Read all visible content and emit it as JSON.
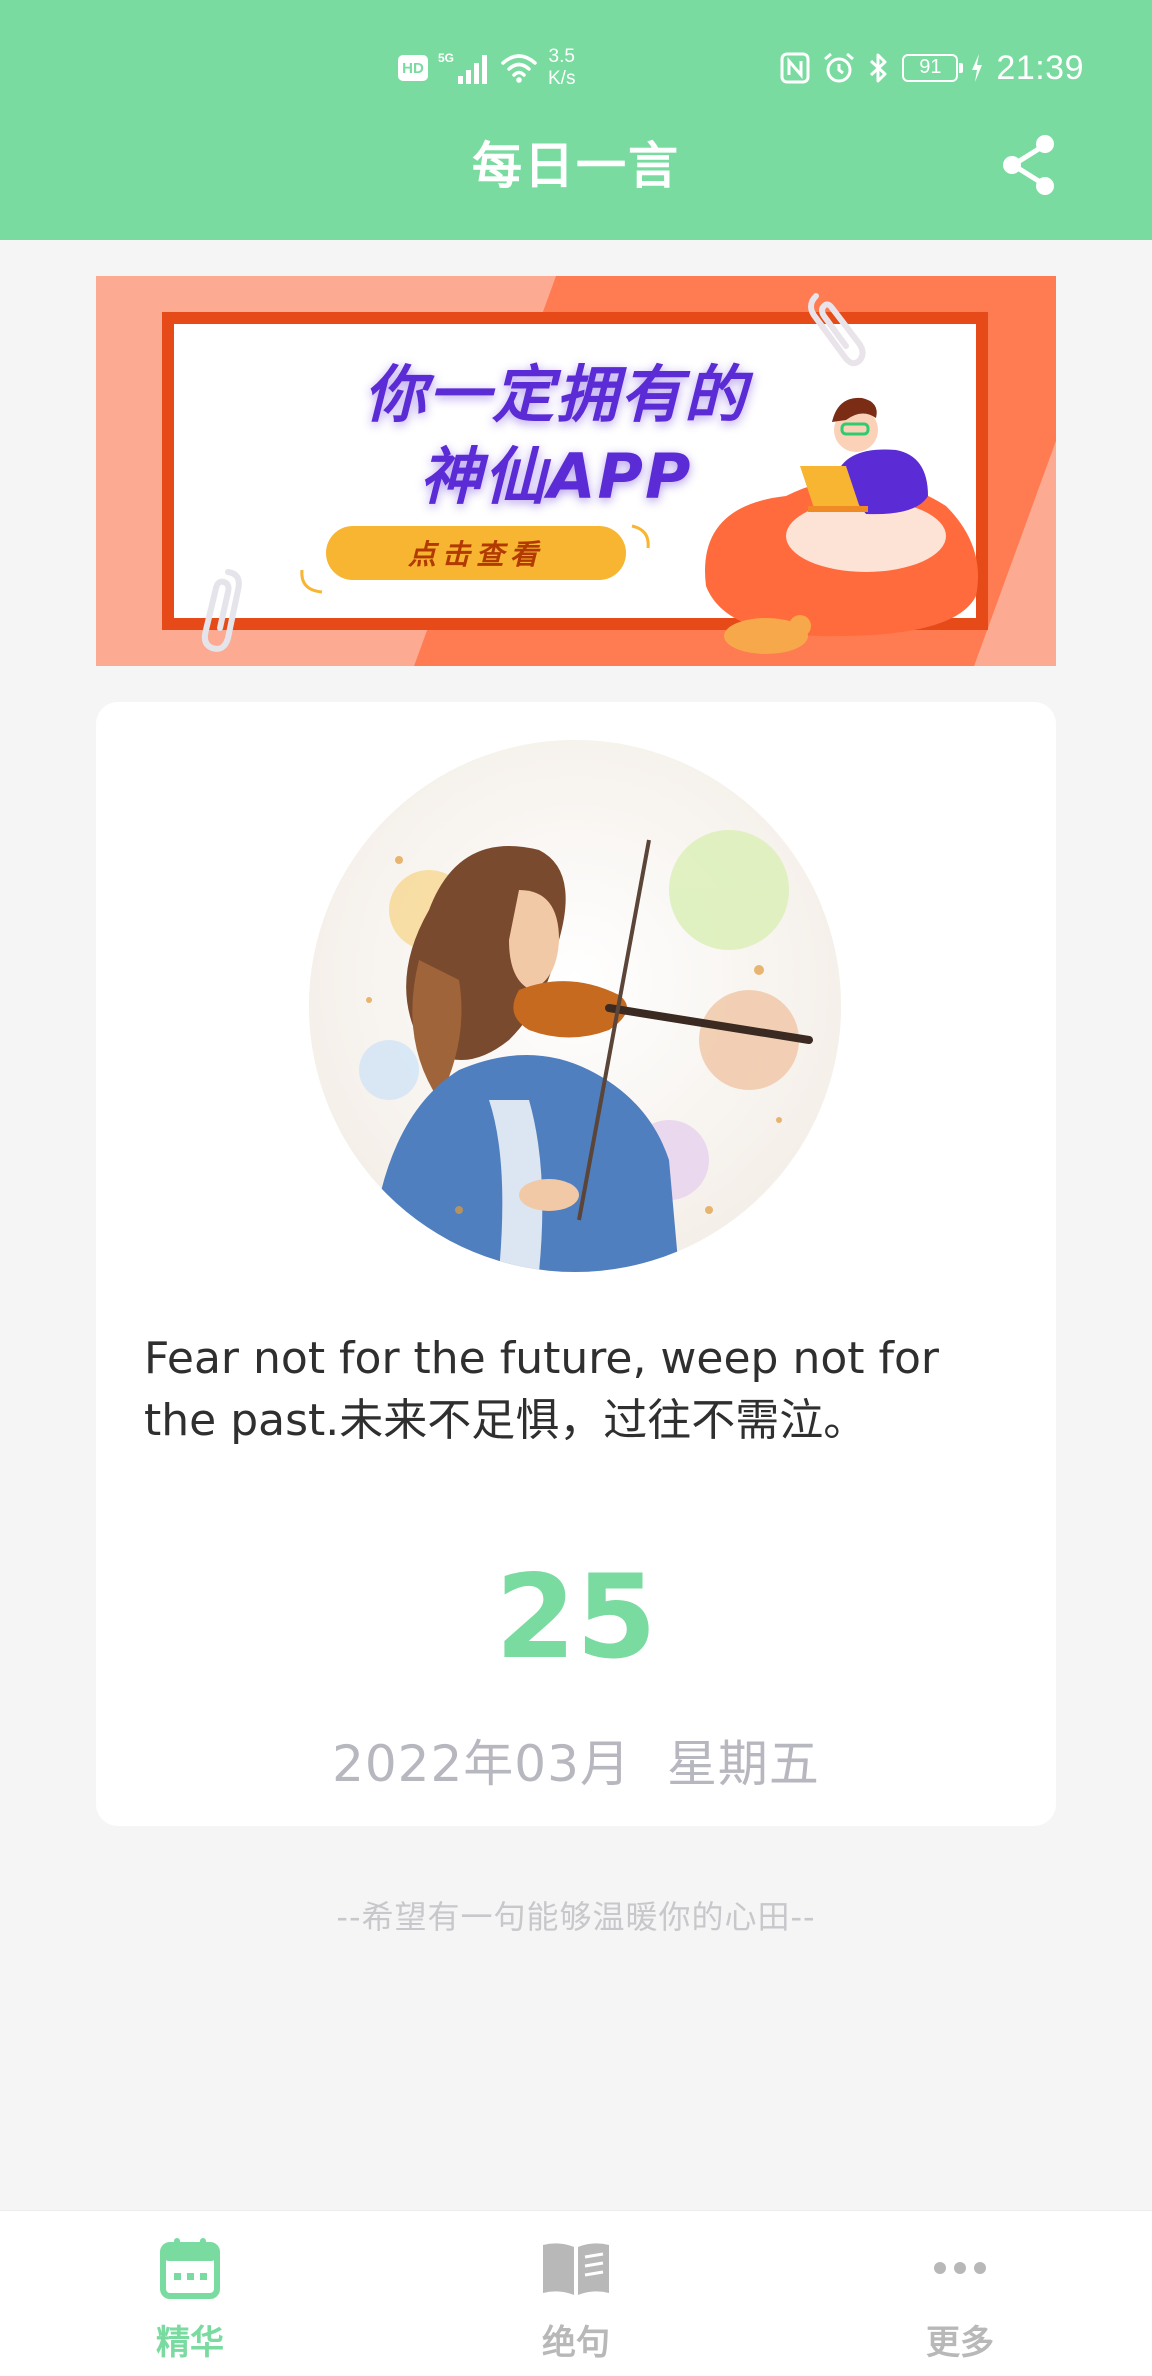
{
  "status_bar": {
    "hd_label": "HD",
    "network_label": "5G",
    "speed_value": "3.5",
    "speed_unit": "K/s",
    "battery_level": "91",
    "time": "21:39"
  },
  "header": {
    "title": "每日一言"
  },
  "banner": {
    "line1": "你一定拥有的",
    "line2": "神仙APP",
    "cta": "点击查看"
  },
  "card": {
    "quote": "Fear not for the future, weep not for the past.未来不足惧，过往不需泣。",
    "day": "25",
    "year_month": "2022年03月",
    "weekday": "星期五"
  },
  "footer_note": "--希望有一句能够温暖你的心田--",
  "bottom_nav": {
    "items": [
      {
        "label": "精华",
        "icon": "calendar-icon",
        "active": true
      },
      {
        "label": "绝句",
        "icon": "book-icon",
        "active": false
      },
      {
        "label": "更多",
        "icon": "more-dots-icon",
        "active": false
      }
    ]
  },
  "colors": {
    "primary": "#79db9f",
    "background": "#f5f5f5",
    "inactive": "#b8b8b8"
  }
}
